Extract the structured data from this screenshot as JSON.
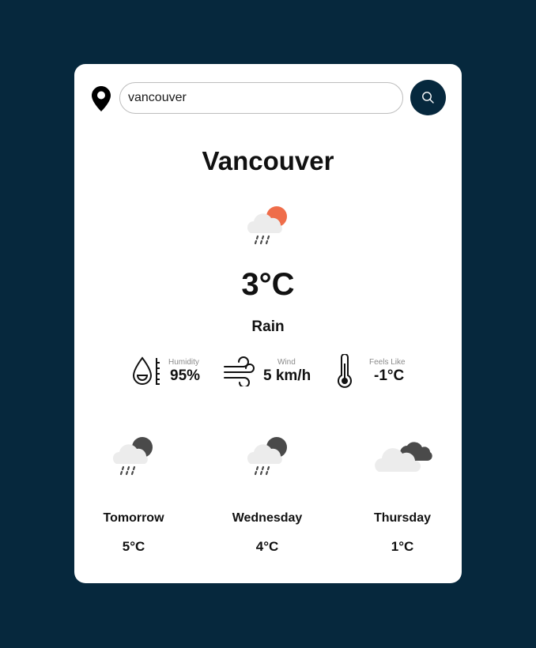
{
  "search": {
    "value": "vancouver",
    "location_icon": "map-pin-icon",
    "button_icon": "search-icon"
  },
  "current": {
    "city": "Vancouver",
    "icon": "rain-cloud-sun-icon",
    "temperature": "3°C",
    "condition": "Rain"
  },
  "metrics": {
    "humidity": {
      "icon": "water-drop-icon",
      "label": "Humidity",
      "value": "95%"
    },
    "wind": {
      "icon": "wind-icon",
      "label": "Wind",
      "value": "5 km/h"
    },
    "feels_like": {
      "icon": "thermometer-icon",
      "label": "Feels Like",
      "value": "-1°C"
    }
  },
  "forecast": [
    {
      "day": "Tomorrow",
      "temp": "5°C",
      "icon": "rain-cloud-moon-icon"
    },
    {
      "day": "Wednesday",
      "temp": "4°C",
      "icon": "rain-cloud-moon-icon"
    },
    {
      "day": "Thursday",
      "temp": "1°C",
      "icon": "cloudy-icon"
    }
  ],
  "colors": {
    "background": "#06283d",
    "card": "#ffffff",
    "sun": "#ef6d4a",
    "cloud": "#ececec",
    "dark_cloud": "#4a4a4a"
  }
}
